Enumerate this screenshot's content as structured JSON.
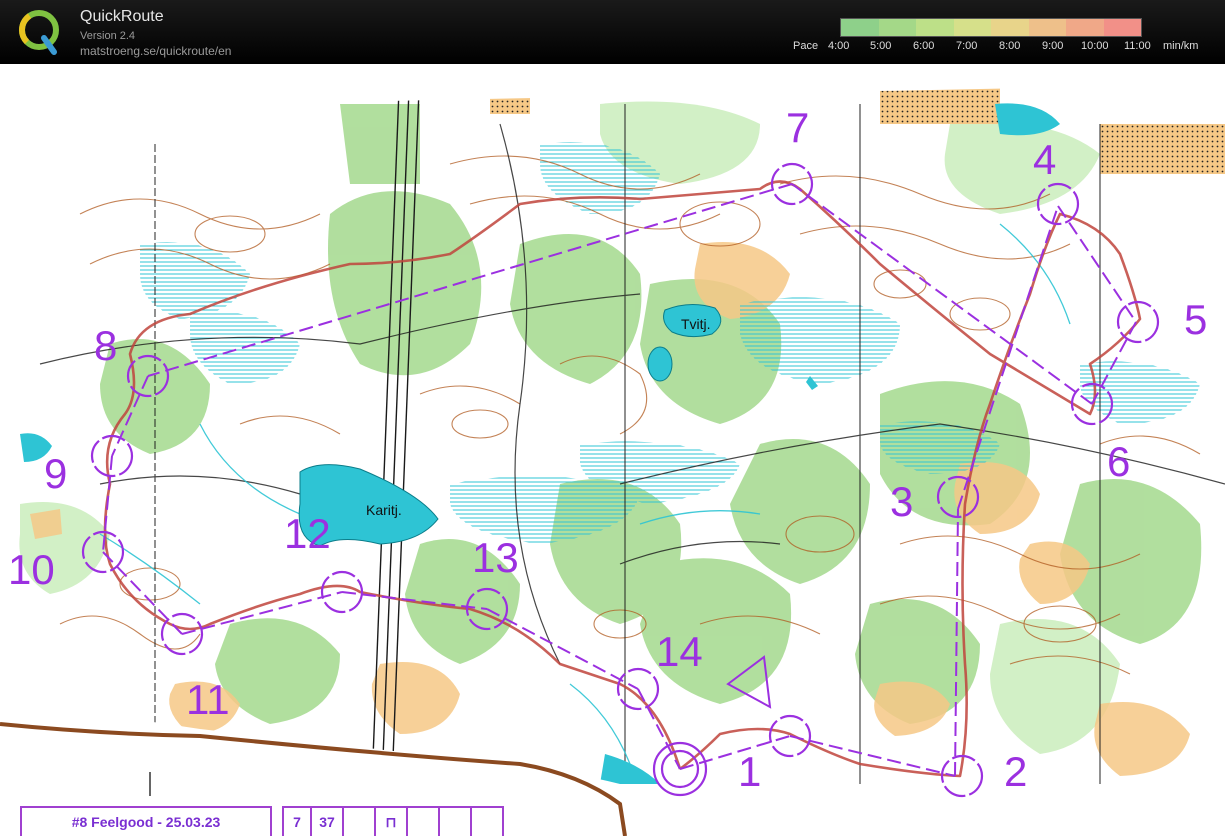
{
  "app": {
    "title": "QuickRoute",
    "version": "Version 2.4",
    "url": "matstroeng.se/quickroute/en",
    "logo_letter": "Q"
  },
  "pace_legend": {
    "label": "Pace",
    "unit": "min/km",
    "ticks": [
      "4:00",
      "5:00",
      "6:00",
      "7:00",
      "8:00",
      "9:00",
      "10:00",
      "11:00"
    ],
    "colors": [
      "#8ed08a",
      "#a4d888",
      "#bde088",
      "#d6e08a",
      "#e8d48a",
      "#eec08a",
      "#f0a888",
      "#f29088"
    ]
  },
  "map": {
    "lakes": [
      "Tvitj.",
      "Karitj."
    ],
    "controls": [
      {
        "label": "1"
      },
      {
        "label": "2"
      },
      {
        "label": "3"
      },
      {
        "label": "4"
      },
      {
        "label": "5"
      },
      {
        "label": "6"
      },
      {
        "label": "7"
      },
      {
        "label": "8"
      },
      {
        "label": "9"
      },
      {
        "label": "10"
      },
      {
        "label": "11"
      },
      {
        "label": "12"
      },
      {
        "label": "13"
      },
      {
        "label": "14"
      }
    ]
  },
  "info_box": {
    "title": "#8 Feelgood - 25.03.23",
    "cells": [
      "7",
      "37",
      "",
      "⊓",
      "",
      "",
      ""
    ]
  },
  "colors": {
    "course": "#9b30e0",
    "route": "#b04040",
    "water": "#2ec4d4",
    "forest_green": "#9ed38a",
    "open_yellow": "#f6c886",
    "contour": "#b0591e"
  }
}
